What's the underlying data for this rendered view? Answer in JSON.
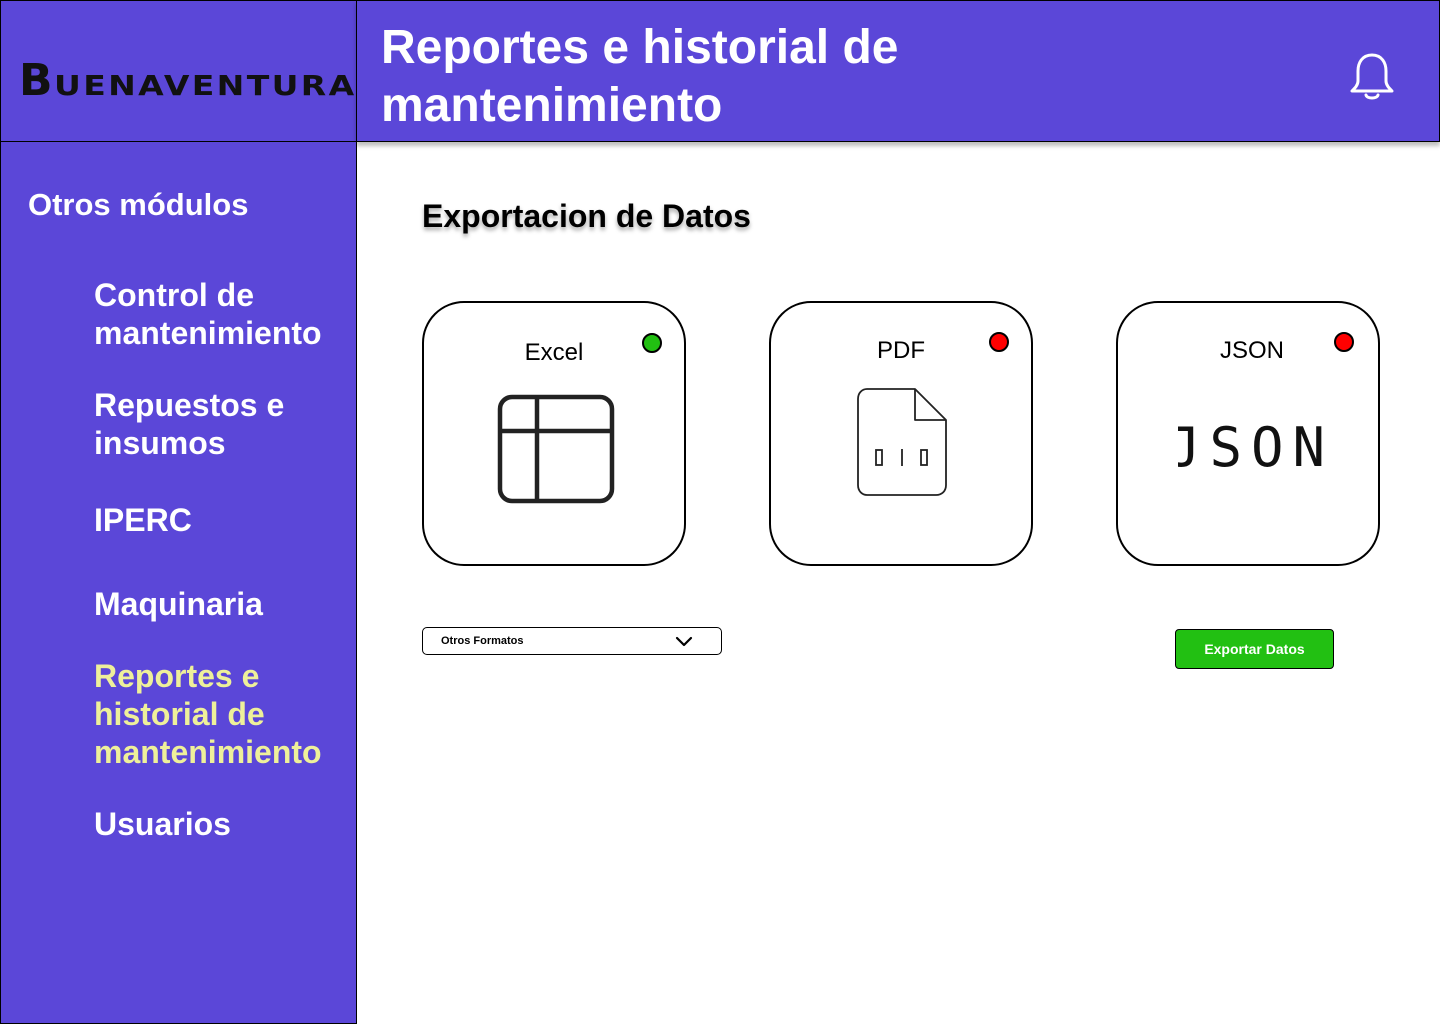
{
  "brand": {
    "logo_initial": "B",
    "logo_rest": "UENAVENTURA"
  },
  "header": {
    "title": "Reportes e historial de mantenimiento",
    "notification_icon": "bell-icon"
  },
  "sidebar": {
    "heading": "Otros módulos",
    "items": [
      {
        "label": "Control de mantenimiento",
        "active": false
      },
      {
        "label": "Repuestos e insumos",
        "active": false
      },
      {
        "label": "IPERC",
        "active": false
      },
      {
        "label": "Maquinaria",
        "active": false
      },
      {
        "label": "Reportes e historial de mantenimiento",
        "active": true
      },
      {
        "label": "Usuarios",
        "active": false
      }
    ]
  },
  "main": {
    "section_title": "Exportacion de Datos",
    "formats": [
      {
        "label": "Excel",
        "status": "selected",
        "status_color": "#22c012",
        "icon": "table-icon"
      },
      {
        "label": "PDF",
        "status": "unselected",
        "status_color": "#ff0000",
        "icon": "binary-file-icon"
      },
      {
        "label": "JSON",
        "status": "unselected",
        "status_color": "#ff0000",
        "icon": "json-icon",
        "icon_text": "JSON"
      }
    ],
    "other_formats": {
      "label": "Otros Formatos"
    },
    "export_button": {
      "label": "Exportar Datos"
    }
  },
  "colors": {
    "primary": "#5b47d8",
    "active_nav": "#eef09a",
    "success": "#22c012",
    "error": "#ff0000"
  }
}
